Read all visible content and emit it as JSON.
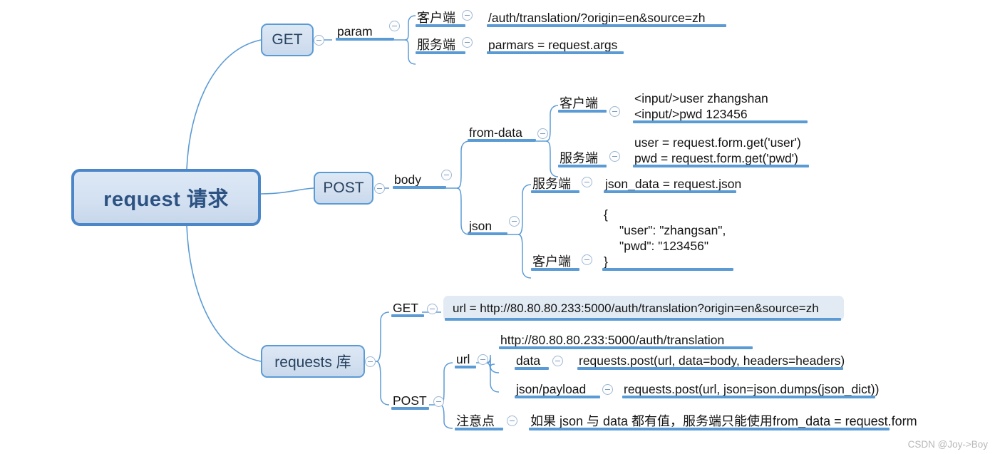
{
  "diagram": {
    "type": "mindmap",
    "title": "request 请求",
    "watermark": "CSDN @Joy->Boy"
  },
  "root": {
    "label": "request 请求"
  },
  "branches": {
    "get": {
      "label": "GET",
      "param": {
        "label": "param"
      },
      "client": {
        "label": "客户端",
        "value": "/auth/translation/?origin=en&source=zh"
      },
      "server": {
        "label": "服务端",
        "value": "parmars = request.args"
      }
    },
    "post": {
      "label": "POST",
      "body": {
        "label": "body"
      },
      "form_data": {
        "label": "from-data",
        "client": {
          "label": "客户端",
          "line1": "<input/>user   zhangshan",
          "line2": "<input/>pwd 123456"
        },
        "server": {
          "label": "服务端",
          "line1": "user = request.form.get('user')",
          "line2": "pwd = request.form.get('pwd')"
        }
      },
      "json": {
        "label": "json",
        "server": {
          "label": "服务端",
          "value": "json_data = request.json"
        },
        "client": {
          "label": "客户端",
          "line1": "{",
          "line2": "\"user\": \"zhangsan\",",
          "line3": "\"pwd\": \"123456\"",
          "line4": "}"
        }
      }
    },
    "requests_lib": {
      "label": "requests 库",
      "get": {
        "label": "GET",
        "url": "url = http://80.80.80.233:5000/auth/translation?origin=en&source=zh"
      },
      "post": {
        "label": "POST",
        "url": {
          "label": "url",
          "value": "http://80.80.80.233:5000/auth/translation",
          "data": {
            "label": "data",
            "value": "requests.post(url, data=body, headers=headers)"
          },
          "json_payload": {
            "label": "json/payload",
            "value": "requests.post(url, json=json.dumps(json_dict))"
          }
        },
        "note": {
          "label": "注意点",
          "value": "如果 json 与 data 都有值，服务端只能使用from_data = request.form"
        }
      }
    },
    "colors": {
      "branch_line": "#5b9bd5",
      "node_border": "#5b9bd5",
      "root_border": "#4a86c8",
      "root_text": "#2c5282",
      "text": "#141414",
      "highlight_fill": "#e2ebf3"
    }
  }
}
